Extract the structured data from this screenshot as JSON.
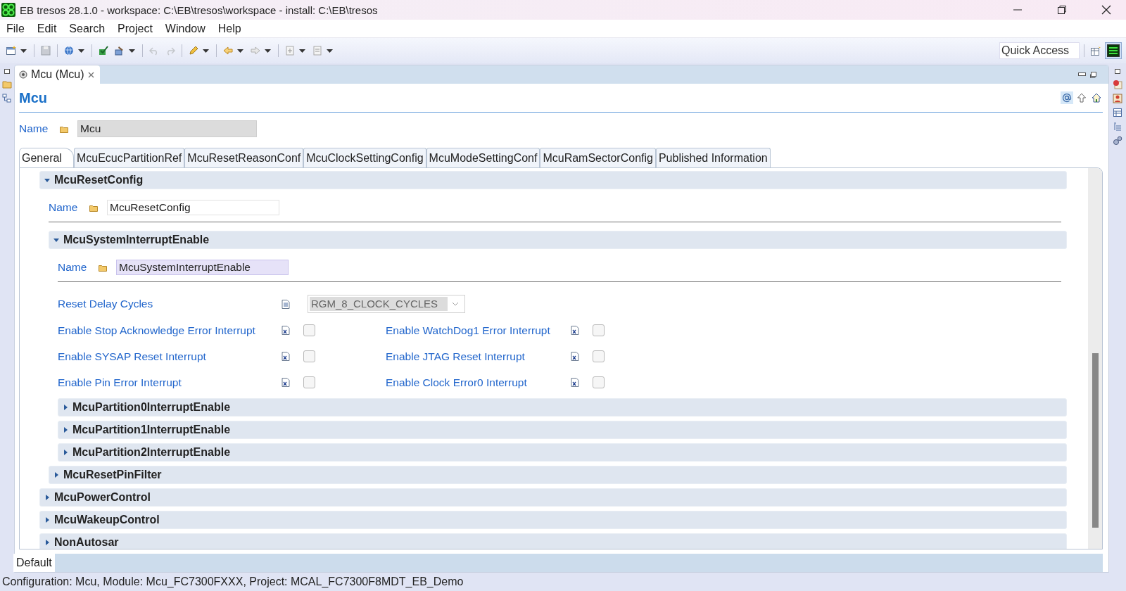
{
  "window": {
    "title": "EB tresos 28.1.0 - workspace: C:\\EB\\tresos\\workspace - install: C:\\EB\\tresos"
  },
  "menu": [
    "File",
    "Edit",
    "Search",
    "Project",
    "Window",
    "Help"
  ],
  "quick_access": {
    "placeholder": "Quick Access"
  },
  "editor_tab": {
    "label": "Mcu (Mcu)"
  },
  "form": {
    "title": "Mcu",
    "name_label": "Name",
    "name_value": "Mcu",
    "name_disabled": true,
    "tabs": [
      {
        "label": "General",
        "selected": true
      },
      {
        "label": "McuEcucPartitionRef",
        "selected": false
      },
      {
        "label": "McuResetReasonConf",
        "selected": false
      },
      {
        "label": "McuClockSettingConfig",
        "selected": false
      },
      {
        "label": "McuModeSettingConf",
        "selected": false
      },
      {
        "label": "McuRamSectorConfig",
        "selected": false
      },
      {
        "label": "Published Information",
        "selected": false
      }
    ],
    "sections": [
      {
        "kind": "section",
        "title": "McuResetConfig",
        "expanded": true,
        "children": [
          {
            "kind": "name",
            "label": "Name",
            "value": "McuResetConfig",
            "focused": false
          },
          {
            "kind": "section",
            "title": "McuSystemInterruptEnable",
            "expanded": true,
            "children": [
              {
                "kind": "name",
                "label": "Name",
                "value": "McuSystemInterruptEnable",
                "focused": true
              },
              {
                "kind": "combo",
                "label": "Reset Delay Cycles",
                "value": "RGM_8_CLOCK_CYCLES",
                "disabled": true
              },
              {
                "kind": "checks",
                "items": [
                  {
                    "label": "Enable Stop Acknowledge Error Interrupt",
                    "checked": false
                  },
                  {
                    "label": "Enable WatchDog1 Error Interrupt",
                    "checked": false
                  },
                  {
                    "label": "Enable SYSAP Reset Interrupt",
                    "checked": false
                  },
                  {
                    "label": "Enable JTAG Reset Interrupt",
                    "checked": false
                  },
                  {
                    "label": "Enable Pin Error Interrupt",
                    "checked": false
                  },
                  {
                    "label": "Enable Clock Error0 Interrupt",
                    "checked": false
                  }
                ]
              },
              {
                "kind": "section",
                "title": "McuPartition0InterruptEnable",
                "expanded": false
              },
              {
                "kind": "section",
                "title": "McuPartition1InterruptEnable",
                "expanded": false
              },
              {
                "kind": "section",
                "title": "McuPartition2InterruptEnable",
                "expanded": false
              }
            ]
          },
          {
            "kind": "section",
            "title": "McuResetPinFilter",
            "expanded": false
          }
        ]
      },
      {
        "kind": "section",
        "title": "McuPowerControl",
        "expanded": false
      },
      {
        "kind": "section",
        "title": "McuWakeupControl",
        "expanded": false
      },
      {
        "kind": "section",
        "title": "NonAutosar",
        "expanded": false
      }
    ]
  },
  "bottom_tabs": [
    {
      "label": "Default",
      "selected": true
    }
  ],
  "status_bar": "Configuration: Mcu, Module: Mcu_FC7300FXXX, Project: MCAL_FC7300F8MDT_EB_Demo"
}
